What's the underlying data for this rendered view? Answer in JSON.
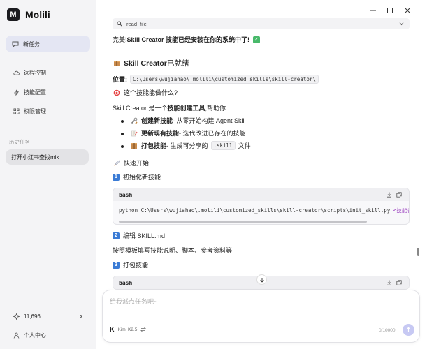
{
  "app": {
    "name": "Molili",
    "logo_glyph": "M"
  },
  "sidebar": {
    "new_task": "新任务",
    "items": [
      {
        "label": "远程控制",
        "icon": "cloud-icon"
      },
      {
        "label": "技能配置",
        "icon": "lightning-icon"
      },
      {
        "label": "权限管理",
        "icon": "grid-icon"
      }
    ],
    "history_label": "历史任务",
    "history": [
      {
        "label": "打开小红书查找mik"
      }
    ],
    "credits": "11,696",
    "user_center": "个人中心"
  },
  "tool_call": {
    "name": "read_file"
  },
  "content": {
    "success_prefix": "完美!",
    "success_bold": "Skill Creator 技能已经安装在你的系统中了!",
    "ready_bold": "Skill Creator",
    "ready_rest": " 已就绪",
    "location_label": "位置:",
    "location_path": "C:\\Users\\wujiahao\\.molili\\customized_skills\\skill-creator\\",
    "what_heading": "这个技能能做什么?",
    "intro_prefix": "Skill Creator 是一个",
    "intro_bold": "技能创建工具",
    "intro_suffix": ",帮助你:",
    "bullets": [
      {
        "bold": "创建新技能",
        "rest": " - 从零开始构建 Agent Skill"
      },
      {
        "bold": "更新现有技能",
        "rest": " - 迭代改进已存在的技能"
      },
      {
        "bold": "打包技能",
        "rest": " - 生成可分享的",
        "code": ".skill",
        "tail": "文件"
      }
    ],
    "quickstart": "快速开始",
    "step1_num": "1",
    "step1": "初始化新技能",
    "code1_lang": "bash",
    "code1_cmd": "python C:\\Users\\wujiahao\\.molili\\customized_skills\\skill-creator\\scripts\\init_skill.py",
    "code1_arg": " <技能名> --",
    "step2_num": "2",
    "step2": "编辑 SKILL.md",
    "step2_desc": "按照模板填写技能说明、脚本、参考资料等",
    "step3_num": "3",
    "step3": "打包技能",
    "code2_lang": "bash"
  },
  "input": {
    "placeholder": "给我派点任务吧~",
    "model_logo": "K",
    "model": "Kimi K2.5",
    "counter": "0/10000"
  },
  "colors": {
    "accent": "#c7c9f3",
    "new_task_bg": "#e4e6f3",
    "check": "#48b96a",
    "step_badge": "#3a7bd5"
  }
}
